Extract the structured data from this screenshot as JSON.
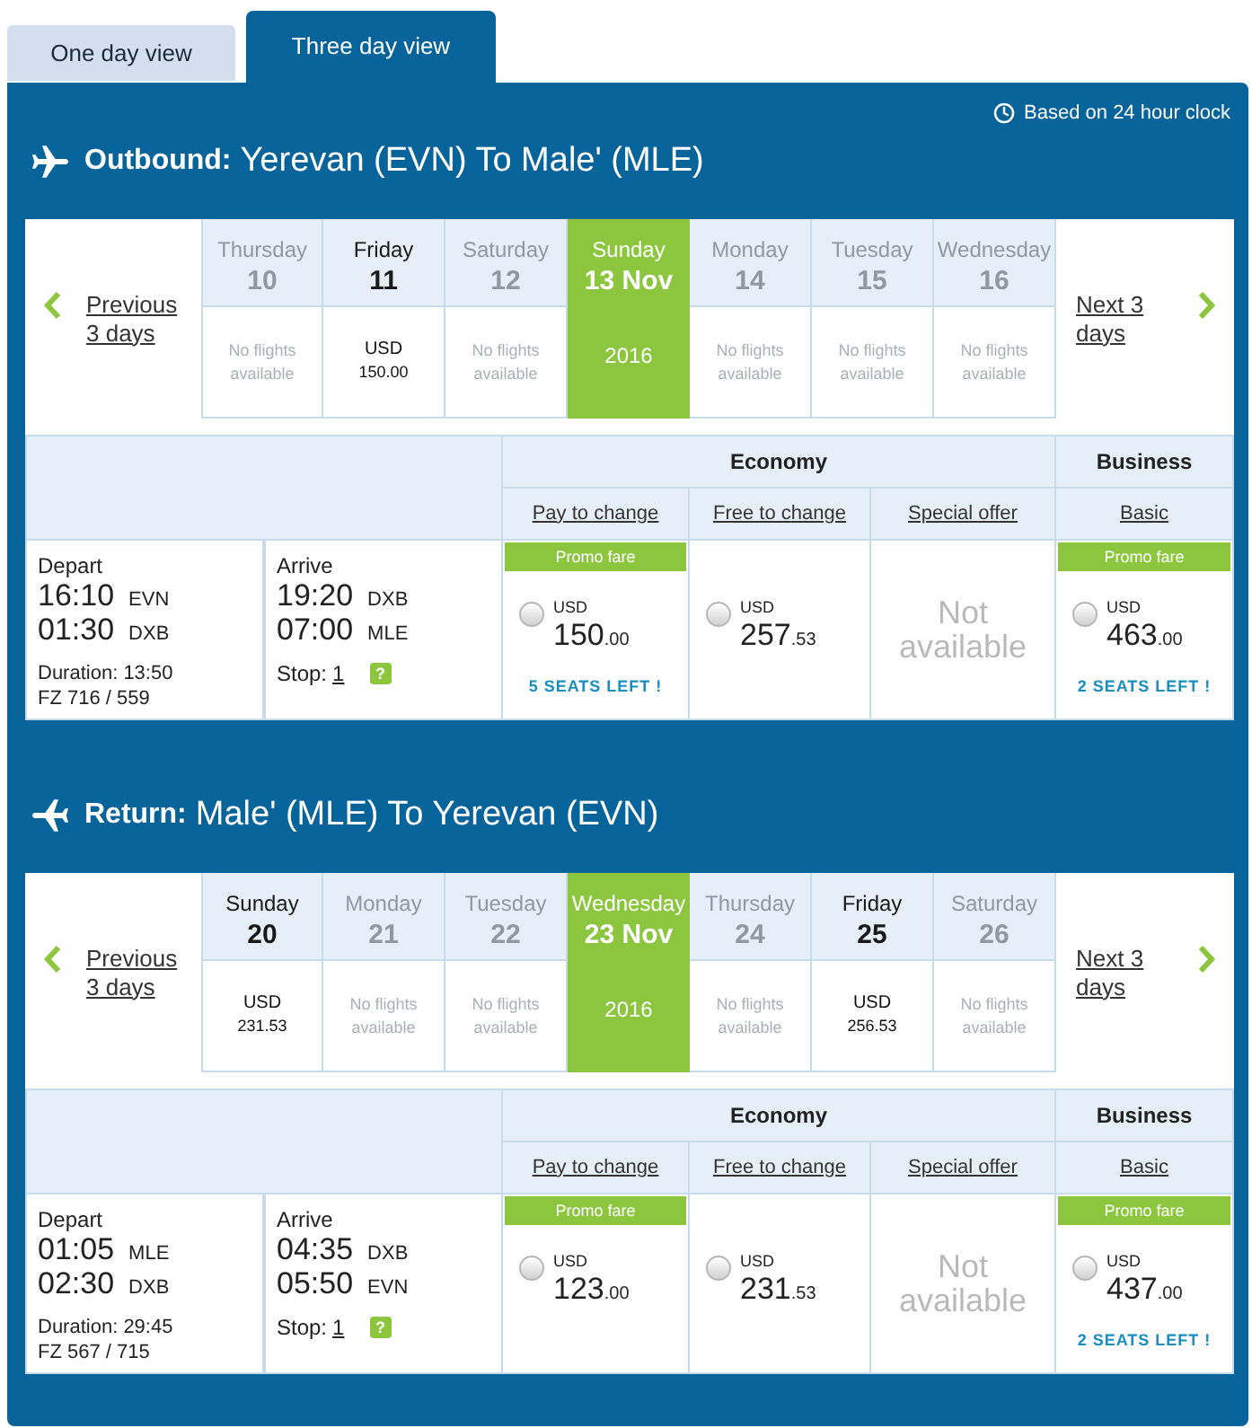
{
  "tabs": [
    {
      "label": "One day view",
      "selected": false
    },
    {
      "label": "Three day view",
      "selected": true
    }
  ],
  "clock_note": "Based on 24 hour clock",
  "journeys": [
    {
      "kind": "outbound",
      "direction": "Outbound:",
      "route": "Yerevan (EVN) To Male' (MLE)",
      "previous_link": "Previous 3 days",
      "next_link": "Next 3 days",
      "days": [
        {
          "weekday": "Thursday",
          "date": "10",
          "available": false,
          "selected": false,
          "kind": "note",
          "note": "No flights available"
        },
        {
          "weekday": "Friday",
          "date": "11",
          "available": true,
          "selected": false,
          "kind": "price",
          "currency": "USD",
          "price": "150.00"
        },
        {
          "weekday": "Saturday",
          "date": "12",
          "available": false,
          "selected": false,
          "kind": "note",
          "note": "No flights available"
        },
        {
          "weekday": "Sunday",
          "date": "13 Nov",
          "available": true,
          "selected": true,
          "kind": "year",
          "year": "2016"
        },
        {
          "weekday": "Monday",
          "date": "14",
          "available": false,
          "selected": false,
          "kind": "note",
          "note": "No flights available"
        },
        {
          "weekday": "Tuesday",
          "date": "15",
          "available": false,
          "selected": false,
          "kind": "note",
          "note": "No flights available"
        },
        {
          "weekday": "Wednesday",
          "date": "16",
          "available": false,
          "selected": false,
          "kind": "note",
          "note": "No flights available"
        }
      ],
      "cabins": [
        {
          "name": "Economy",
          "fare_types": [
            "Pay to change",
            "Free to change",
            "Special offer"
          ]
        },
        {
          "name": "Business",
          "fare_types": [
            "Basic"
          ]
        }
      ],
      "flight": {
        "depart": {
          "label": "Depart",
          "segments": [
            {
              "time": "16:10",
              "airport": "EVN"
            },
            {
              "time": "01:30",
              "airport": "DXB"
            }
          ],
          "duration": "Duration: 13:50",
          "flight_numbers": "FZ 716 / 559"
        },
        "arrive": {
          "label": "Arrive",
          "segments": [
            {
              "time": "19:20",
              "airport": "DXB"
            },
            {
              "time": "07:00",
              "airport": "MLE"
            }
          ],
          "stop_label": "Stop:",
          "stops": "1",
          "help": "?"
        },
        "fares": [
          {
            "kind": "fare",
            "promo": "Promo fare",
            "selected": false,
            "currency": "USD",
            "amount": "150",
            "fraction": ".00",
            "seats_left": "5 SEATS LEFT !"
          },
          {
            "kind": "fare",
            "selected": false,
            "currency": "USD",
            "amount": "257",
            "fraction": ".53"
          },
          {
            "kind": "unavailable",
            "text": "Not available"
          },
          {
            "kind": "fare",
            "promo": "Promo fare",
            "selected": false,
            "currency": "USD",
            "amount": "463",
            "fraction": ".00",
            "seats_left": "2 SEATS LEFT !"
          }
        ]
      }
    },
    {
      "kind": "return",
      "direction": "Return:",
      "route": "Male' (MLE) To Yerevan (EVN)",
      "previous_link": "Previous 3 days",
      "next_link": "Next 3 days",
      "days": [
        {
          "weekday": "Sunday",
          "date": "20",
          "available": true,
          "selected": false,
          "kind": "price",
          "currency": "USD",
          "price": "231.53"
        },
        {
          "weekday": "Monday",
          "date": "21",
          "available": false,
          "selected": false,
          "kind": "note",
          "note": "No flights available"
        },
        {
          "weekday": "Tuesday",
          "date": "22",
          "available": false,
          "selected": false,
          "kind": "note",
          "note": "No flights available"
        },
        {
          "weekday": "Wednesday",
          "date": "23 Nov",
          "available": true,
          "selected": true,
          "kind": "year",
          "year": "2016"
        },
        {
          "weekday": "Thursday",
          "date": "24",
          "available": false,
          "selected": false,
          "kind": "note",
          "note": "No flights available"
        },
        {
          "weekday": "Friday",
          "date": "25",
          "available": true,
          "selected": false,
          "kind": "price",
          "currency": "USD",
          "price": "256.53"
        },
        {
          "weekday": "Saturday",
          "date": "26",
          "available": false,
          "selected": false,
          "kind": "note",
          "note": "No flights available"
        }
      ],
      "cabins": [
        {
          "name": "Economy",
          "fare_types": [
            "Pay to change",
            "Free to change",
            "Special offer"
          ]
        },
        {
          "name": "Business",
          "fare_types": [
            "Basic"
          ]
        }
      ],
      "flight": {
        "depart": {
          "label": "Depart",
          "segments": [
            {
              "time": "01:05",
              "airport": "MLE"
            },
            {
              "time": "02:30",
              "airport": "DXB"
            }
          ],
          "duration": "Duration: 29:45",
          "flight_numbers": "FZ 567 / 715"
        },
        "arrive": {
          "label": "Arrive",
          "segments": [
            {
              "time": "04:35",
              "airport": "DXB"
            },
            {
              "time": "05:50",
              "airport": "EVN"
            }
          ],
          "stop_label": "Stop:",
          "stops": "1",
          "help": "?"
        },
        "fares": [
          {
            "kind": "fare",
            "promo": "Promo fare",
            "selected": false,
            "currency": "USD",
            "amount": "123",
            "fraction": ".00"
          },
          {
            "kind": "fare",
            "selected": false,
            "currency": "USD",
            "amount": "231",
            "fraction": ".53"
          },
          {
            "kind": "unavailable",
            "text": "Not available"
          },
          {
            "kind": "fare",
            "promo": "Promo fare",
            "selected": false,
            "currency": "USD",
            "amount": "437",
            "fraction": ".00",
            "seats_left": "2 SEATS LEFT !"
          }
        ]
      }
    }
  ]
}
